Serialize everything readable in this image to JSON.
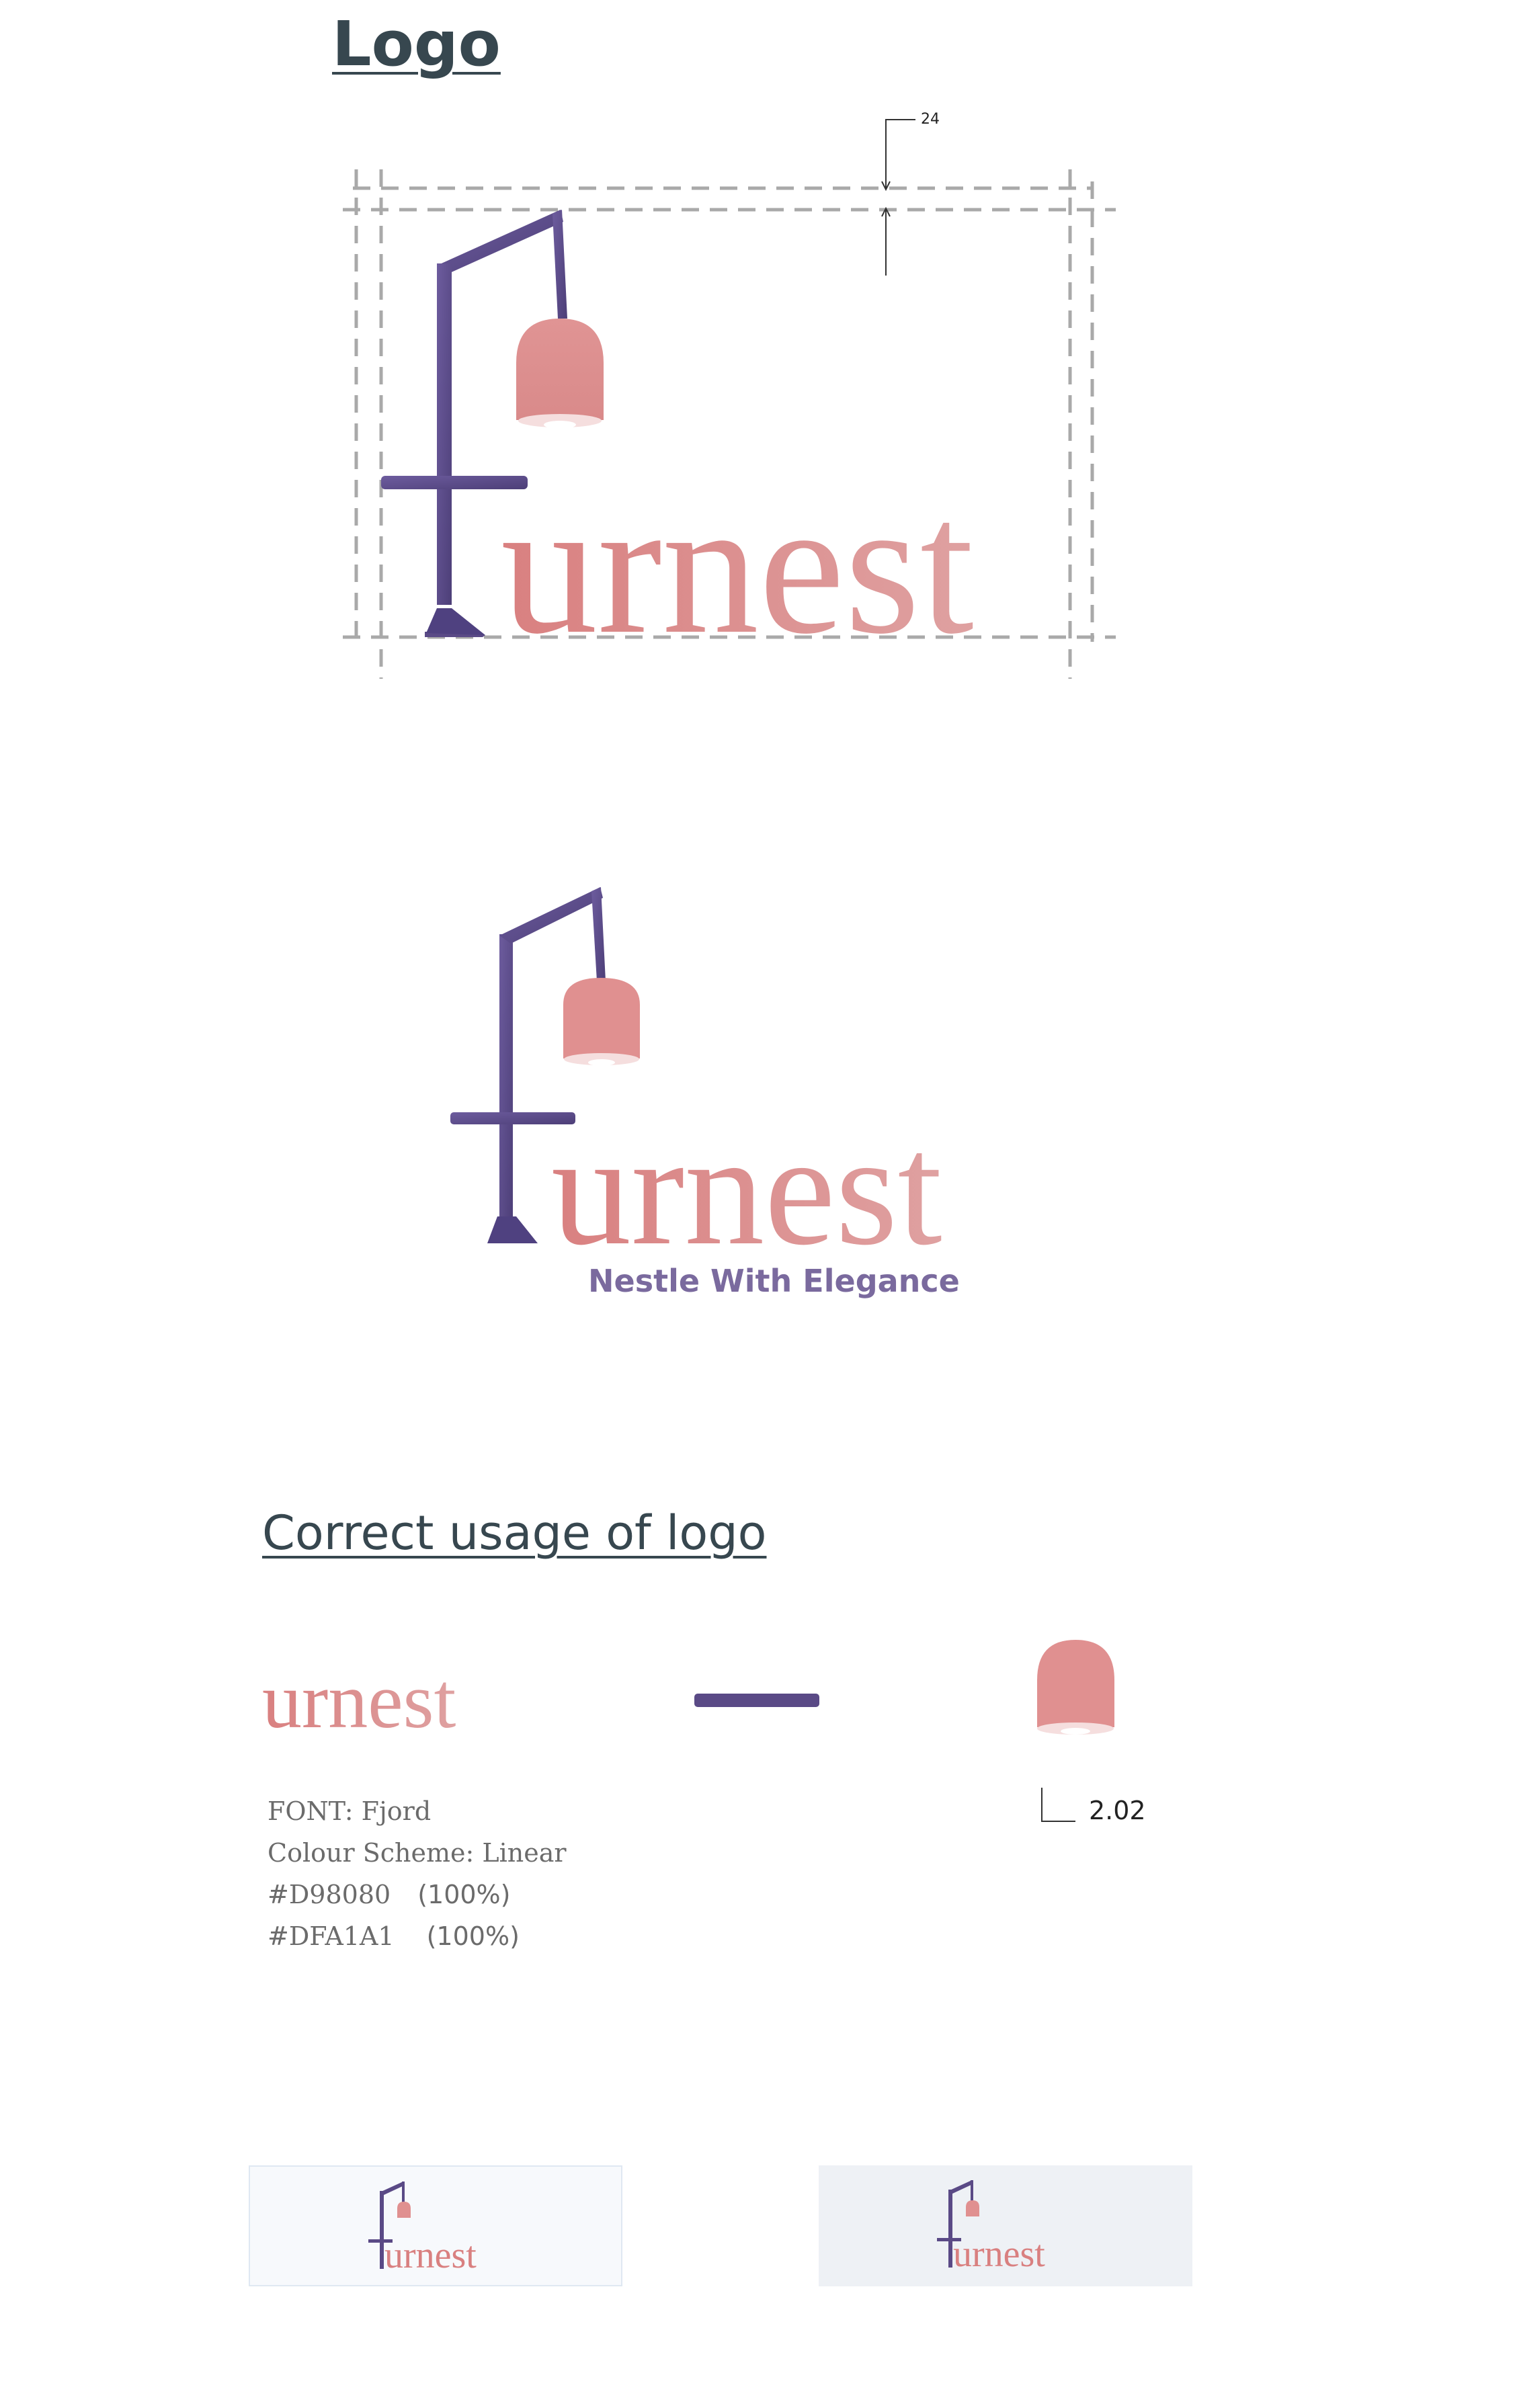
{
  "headings": {
    "logo": "Logo",
    "correct_usage": "Correct usage of logo"
  },
  "logo": {
    "wordmark": "urnest",
    "tagline": "Nestle With Elegance"
  },
  "guides": {
    "margin_value": "24"
  },
  "font_spec": {
    "font": "FONT: Fjord",
    "colour_scheme": "Colour Scheme: Linear",
    "colors": [
      {
        "hex": "#D98080",
        "pct": "(100%)"
      },
      {
        "hex": "#DFA1A1",
        "pct": "(100%)"
      }
    ]
  },
  "bulb_measure": "2.02",
  "palette": {
    "purple": "#5a4a86",
    "purple_light": "#7a6aa8",
    "pink": "#D98080",
    "pink_light": "#DFA1A1",
    "tagline_purple": "#7a6a9e",
    "heading": "#37474f",
    "card_light_bg": "#f7f9fc",
    "card_gray_bg": "#eef1f5"
  }
}
